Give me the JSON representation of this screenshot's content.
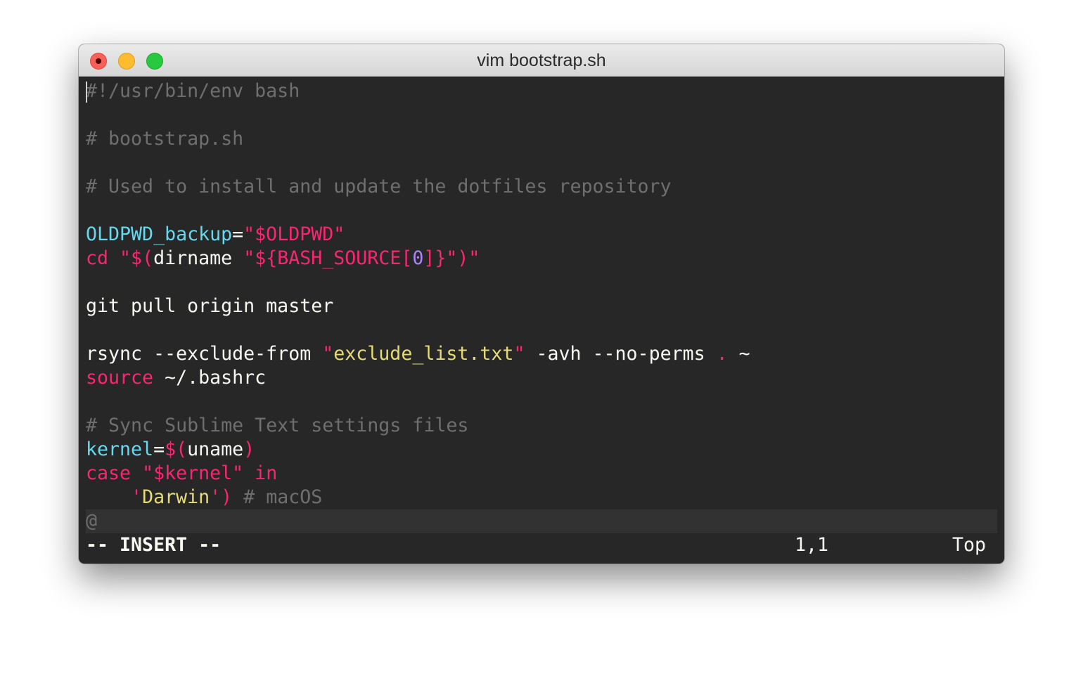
{
  "window": {
    "title": "vim bootstrap.sh",
    "controls": [
      "close",
      "minimize",
      "maximize"
    ]
  },
  "colors": {
    "background": "#272727",
    "comment": "#6f6f6f",
    "keyword": "#f92672",
    "variable": "#66d9ef",
    "string": "#e6db74",
    "number": "#ae81ff",
    "text": "#f8f8f2"
  },
  "editor": {
    "lines": [
      [
        [
          "#!/usr/bin/env bash",
          "comment"
        ]
      ],
      [],
      [
        [
          "# bootstrap.sh",
          "comment"
        ]
      ],
      [],
      [
        [
          "# Used to install and update the dotfiles repository",
          "comment"
        ]
      ],
      [],
      [
        [
          "OLDPWD_backup",
          "cyan"
        ],
        [
          "=",
          "white"
        ],
        [
          "\"$OLDPWD\"",
          "pink"
        ]
      ],
      [
        [
          "cd ",
          "pink"
        ],
        [
          "\"$(",
          "pink"
        ],
        [
          "dirname ",
          "white"
        ],
        [
          "\"${BASH_SOURCE[",
          "pink"
        ],
        [
          "0",
          "purple"
        ],
        [
          "]}\")\"",
          "pink"
        ]
      ],
      [],
      [
        [
          "git pull origin master",
          "white"
        ]
      ],
      [],
      [
        [
          "rsync --exclude-from ",
          "white"
        ],
        [
          "\"",
          "pink"
        ],
        [
          "exclude_list.txt",
          "yellow"
        ],
        [
          "\"",
          "pink"
        ],
        [
          " -avh --no-perms ",
          "white"
        ],
        [
          ".",
          "pink"
        ],
        [
          " ~",
          "white"
        ]
      ],
      [
        [
          "source",
          "pink"
        ],
        [
          " ~/.bashrc",
          "white"
        ]
      ],
      [],
      [
        [
          "# Sync Sublime Text settings files",
          "comment"
        ]
      ],
      [
        [
          "kernel",
          "cyan"
        ],
        [
          "=",
          "white"
        ],
        [
          "$(",
          "pink"
        ],
        [
          "uname",
          "white"
        ],
        [
          ")",
          "pink"
        ]
      ],
      [
        [
          "case ",
          "pink"
        ],
        [
          "\"$kernel\"",
          "pink"
        ],
        [
          " in",
          "pink"
        ]
      ],
      [
        [
          "    ",
          "white"
        ],
        [
          "'",
          "pink"
        ],
        [
          "Darwin",
          "yellow"
        ],
        [
          "')",
          "pink"
        ],
        [
          " # macOS",
          "comment"
        ]
      ],
      [
        [
          "@",
          "tilde"
        ]
      ]
    ],
    "cursor": {
      "line": 1,
      "column": 1
    }
  },
  "status": {
    "mode": "-- INSERT --",
    "position": "1,1",
    "scroll": "Top"
  }
}
